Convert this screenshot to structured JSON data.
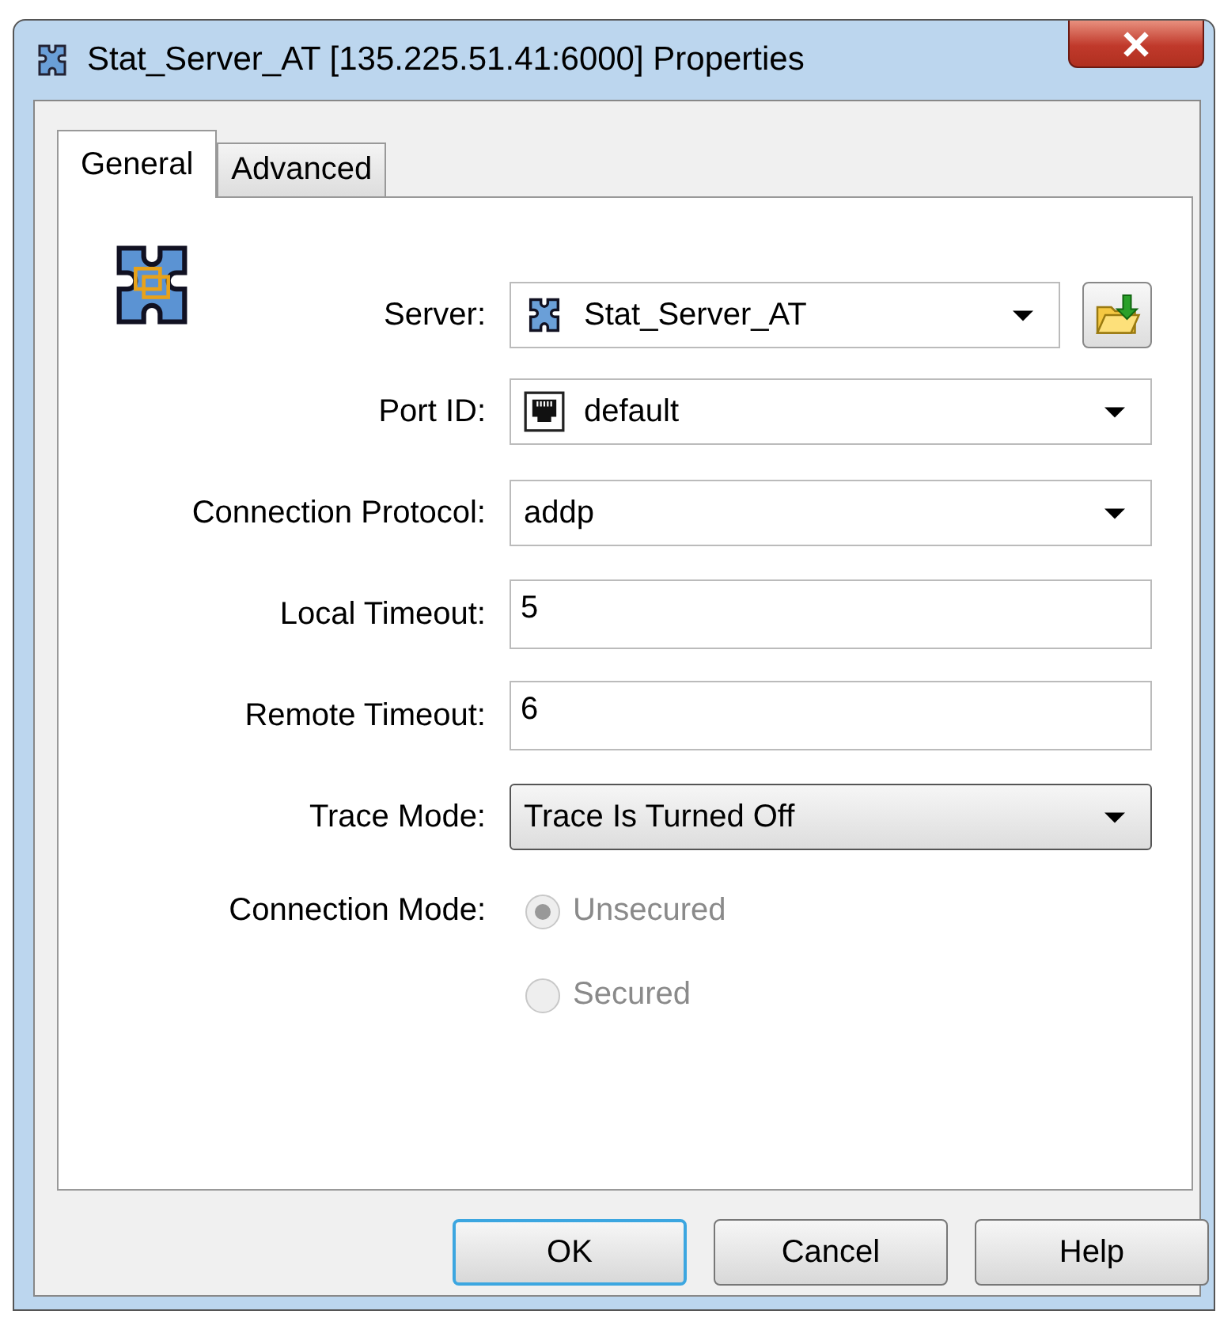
{
  "window": {
    "title": "Stat_Server_AT [135.225.51.41:6000] Properties"
  },
  "tabs": [
    {
      "label": "General",
      "selected": true
    },
    {
      "label": "Advanced",
      "selected": false
    }
  ],
  "fields": [
    {
      "kind": "combo",
      "label": "Server:",
      "value": "Stat_Server_AT",
      "browse": true
    },
    {
      "kind": "combo",
      "label": "Port ID:",
      "value": "default",
      "browse": false
    },
    {
      "kind": "combo",
      "label": "Connection Protocol:",
      "value": "addp",
      "browse": false
    },
    {
      "kind": "text",
      "label": "Local Timeout:",
      "value": "5"
    },
    {
      "kind": "text",
      "label": "Remote Timeout:",
      "value": "6"
    },
    {
      "kind": "dropdown",
      "label": "Trace Mode:",
      "value": "Trace Is Turned Off"
    },
    {
      "kind": "radio",
      "label": "Connection Mode:",
      "disabled": true,
      "options": [
        {
          "label": "Unsecured",
          "selected": true
        },
        {
          "label": "Secured",
          "selected": false
        }
      ]
    }
  ],
  "buttons": [
    {
      "label": "OK",
      "default": true
    },
    {
      "label": "Cancel",
      "default": false
    },
    {
      "label": "Help",
      "default": false
    }
  ]
}
